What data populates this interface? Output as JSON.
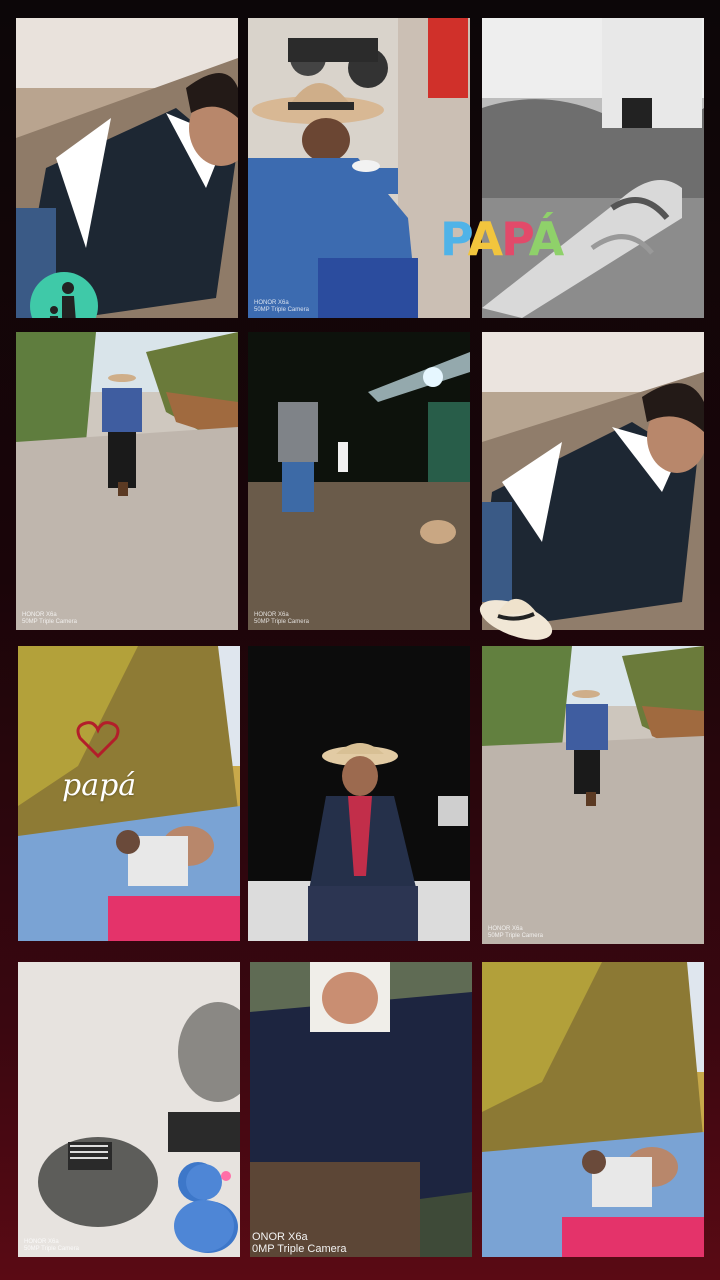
{
  "collage": {
    "watermark_small": "HONOR X6a\n50MP Triple Camera",
    "watermark_large_line1": "ONOR X6a",
    "watermark_large_line2": "0MP Triple Camera",
    "title_sticker": "PAPÁ",
    "script_sticker": "papá"
  },
  "colors": {
    "background": "#1a0509",
    "accent_red": "#c0392b",
    "sticker_teal": "#3fc9a8"
  },
  "icons": [
    "father-child-silhouette-icon",
    "heart-icon",
    "cowboy-hat-sticker-icon",
    "emoji-hug-sticker-icon"
  ]
}
